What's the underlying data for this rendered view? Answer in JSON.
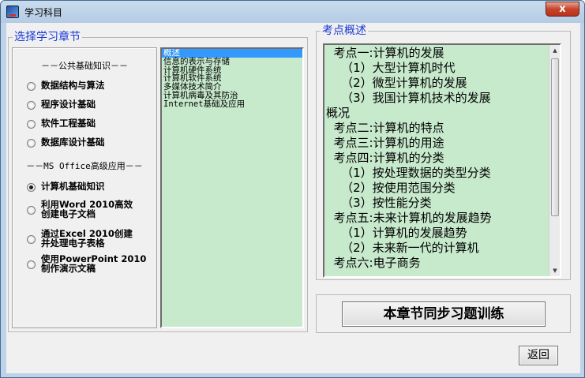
{
  "window": {
    "title": "学习科目",
    "close_glyph": "x"
  },
  "left_panel": {
    "group_label": "选择学习章节",
    "section_basic": "－－公共基础知识－－",
    "basic_options": [
      {
        "label": "数据结构与算法",
        "checked": false
      },
      {
        "label": "程序设计基础",
        "checked": false
      },
      {
        "label": "软件工程基础",
        "checked": false
      },
      {
        "label": "数据库设计基础",
        "checked": false
      }
    ],
    "section_office": "－－MS Office高级应用－－",
    "office_options": [
      {
        "label": "计算机基础知识",
        "checked": true
      },
      {
        "label": "利用Word 2010高效\n创建电子文档",
        "checked": false
      },
      {
        "label": "通过Excel 2010创建\n并处理电子表格",
        "checked": false
      },
      {
        "label": "使用PowerPoint 2010\n制作演示文稿",
        "checked": false
      }
    ],
    "chapter_list": [
      "概述",
      "信息的表示与存储",
      "计算机硬件系统",
      "计算机软件系统",
      "多媒体技术简介",
      "计算机病毒及其防治",
      "Internet基础及应用"
    ],
    "selected_chapter_index": 0
  },
  "right_panel": {
    "group_label": "考点概述",
    "content_lines": [
      "  考点一:计算机的发展",
      "    （1）大型计算机时代",
      "    （2）微型计算机的发展",
      "    （3）我国计算机技术的发展",
      "概况",
      "  考点二:计算机的特点",
      "  考点三:计算机的用途",
      "  考点四:计算机的分类",
      "    （1）按处理数据的类型分类",
      "    （2）按使用范围分类",
      "    （3）按性能分类",
      "  考点五:未来计算机的发展趋势",
      "    （1）计算机的发展趋势",
      "    （2）未来新一代的计算机",
      "  考点六:电子商务"
    ]
  },
  "buttons": {
    "train": "本章节同步习题训练",
    "back": "返回"
  }
}
